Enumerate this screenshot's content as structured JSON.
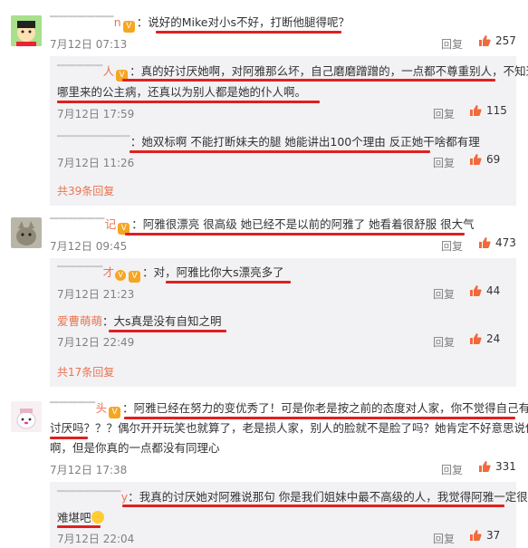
{
  "comments": [
    {
      "name_visible": "n",
      "text": "说好的Mike对小s不好，打断他腿得呢？",
      "date": "7月12日 07:13",
      "reply": "回复",
      "likes": "257",
      "replies": [
        {
          "name_visible": "人",
          "text_line1": "真的好讨厌她啊，对阿雅那么坏，自己磨磨蹭蹭的，一点都不尊重别人，不知道",
          "text_line2": "哪里来的公主病，还真以为别人都是她的仆人啊。",
          "date": "7月12日 17:59",
          "reply": "回复",
          "likes": "115"
        },
        {
          "name_visible": "",
          "text": "她双标啊 不能打断妹夫的腿 她能讲出100个理由 反正她干啥都有理",
          "date": "7月12日 11:26",
          "reply": "回复",
          "likes": "69"
        }
      ],
      "more": "共39条回复"
    },
    {
      "name_visible": "记",
      "text": "阿雅很漂亮 很高级 她已经不是以前的阿雅了 她看着很舒服 很大气",
      "date": "7月12日 09:45",
      "reply": "回复",
      "likes": "473",
      "replies": [
        {
          "name_visible": "才",
          "text": "对，阿雅比你大s漂亮多了",
          "date": "7月12日 21:23",
          "reply": "回复",
          "likes": "44"
        },
        {
          "name": "爱曹萌萌",
          "text": "大s真是没有自知之明",
          "date": "7月12日 22:49",
          "reply": "回复",
          "likes": "24"
        }
      ],
      "more": "共17条回复"
    },
    {
      "name_visible": "头",
      "text_line1": "阿雅已经在努力的变优秀了！可是你老是按之前的态度对人家，你不觉得自己有点",
      "text_line2": "讨厌吗？？？偶尔开开玩笑也就算了，老是损人家，别人的脸就不是脸了吗？她肯定不好意思说你",
      "text_line3": "啊，但是你真的一点都没有同理心",
      "date": "7月12日 17:38",
      "reply": "回复",
      "likes": "331",
      "replies": [
        {
          "name_visible": "y",
          "text_line1": "我真的讨厌她对阿雅说那句 你是我们姐妹中最不高级的人，我觉得阿雅一定很",
          "text_line2": "难堪吧",
          "date": "7月12日 22:04",
          "reply": "回复",
          "likes": "37"
        }
      ]
    }
  ],
  "colors": {
    "accent": "#eb7350",
    "underline": "#e02020",
    "subbg": "#f2f2f5"
  },
  "icons": [
    "avatar",
    "vip-badge",
    "thumbs-up-icon",
    "emoji-icon"
  ]
}
